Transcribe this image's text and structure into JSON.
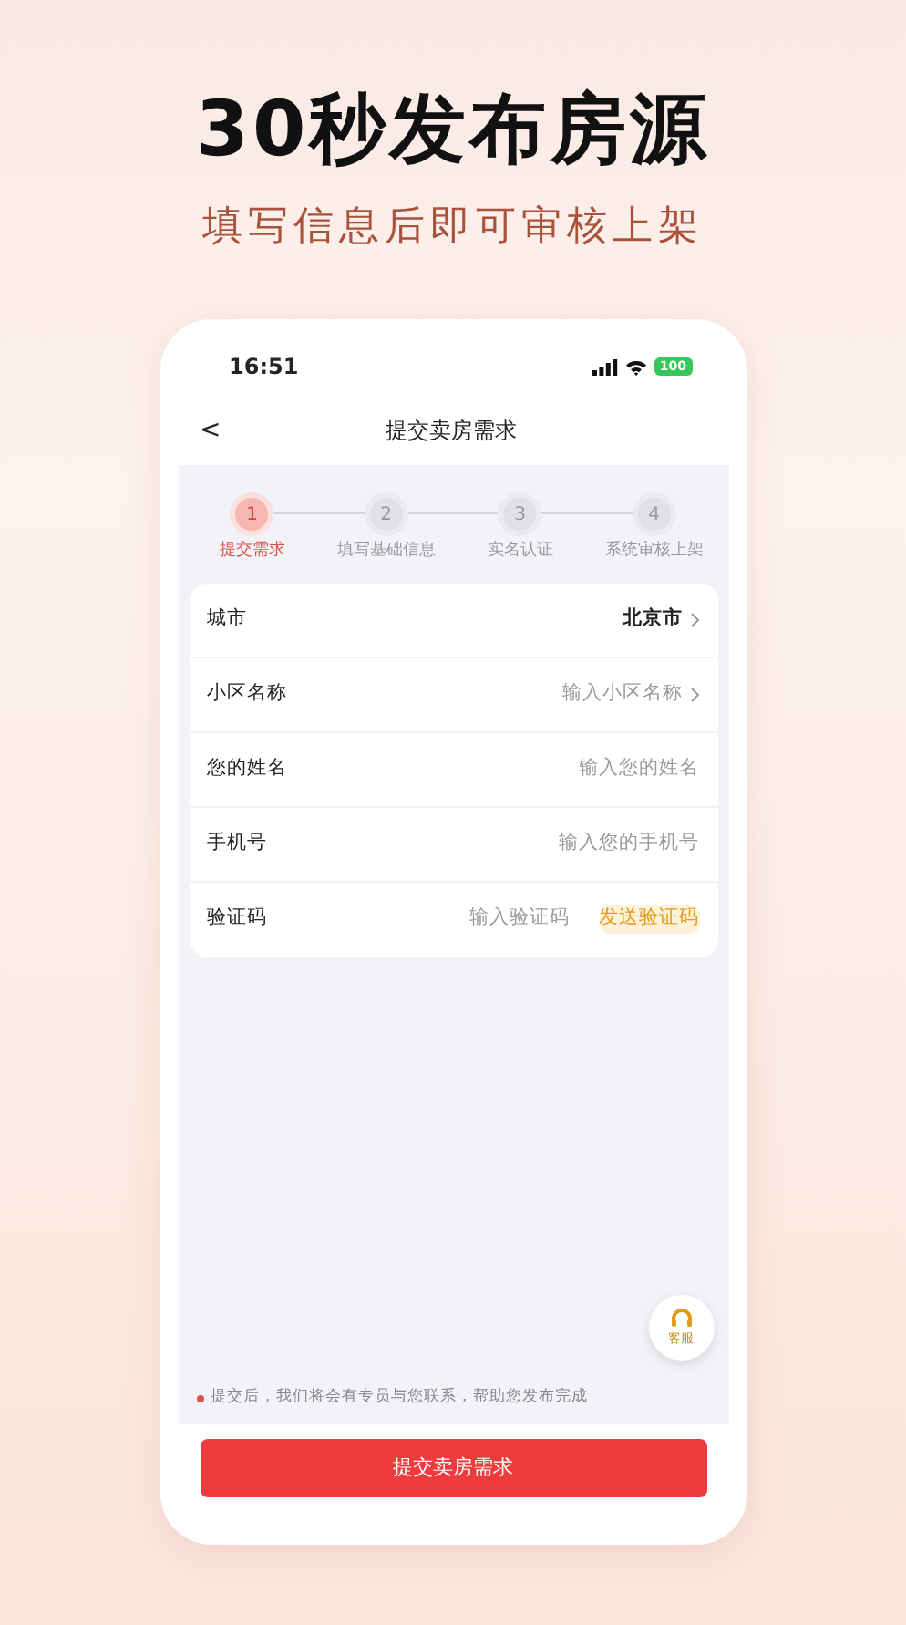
{
  "headline": "30秒发布房源",
  "subheadline": "填写信息后即可审核上架",
  "phone": {
    "status_bar": {
      "time": "16:51",
      "battery": "100"
    },
    "nav": {
      "back": "<",
      "title": "提交卖房需求"
    },
    "steps": [
      {
        "number": "1",
        "label": "提交需求",
        "selected": true
      },
      {
        "number": "2",
        "label": "填写基础信息",
        "selected": false
      },
      {
        "number": "3",
        "label": "实名认证",
        "selected": false
      },
      {
        "number": "4",
        "label": "系统审核上架",
        "selected": false
      }
    ],
    "form": [
      {
        "kind": "select",
        "label": "城市",
        "value": "北京市"
      },
      {
        "kind": "select",
        "label": "小区名称",
        "placeholder": "输入小区名称"
      },
      {
        "kind": "input",
        "label": "您的姓名",
        "placeholder": "输入您的姓名"
      },
      {
        "kind": "input",
        "label": "手机号",
        "placeholder": "输入您的手机号"
      },
      {
        "kind": "code",
        "label": "验证码",
        "placeholder": "输入验证码",
        "action": "发送验证码"
      }
    ],
    "service_button": "客服",
    "note": "提交后，我们将会有专员与您联系，帮助您发布完成",
    "submit_button": "提交卖房需求"
  }
}
